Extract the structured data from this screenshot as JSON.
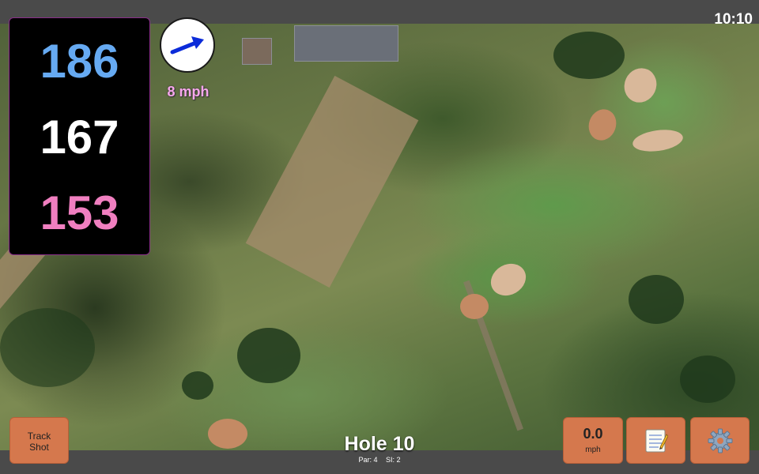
{
  "status": {
    "time": "10:10"
  },
  "distances": {
    "back": "186",
    "middle": "167",
    "front": "153"
  },
  "wind": {
    "speed_label": "8 mph",
    "arrow_icon": "wind-arrow-icon",
    "arrow_color": "#0b2bd9"
  },
  "buttons": {
    "track_line1": "Track",
    "track_line2": "Shot",
    "speed_value": "0.0",
    "speed_unit": "mph",
    "notes_icon": "notepad-icon",
    "settings_icon": "gear-icon"
  },
  "hole": {
    "title": "Hole 10",
    "par": "Par: 4",
    "si": "SI: 2"
  },
  "colors": {
    "back_distance": "#66aaf2",
    "middle_distance": "#ffffff",
    "front_distance": "#f07fc0",
    "button_bg": "#d5784d",
    "panel_border": "#8a2d8a"
  }
}
